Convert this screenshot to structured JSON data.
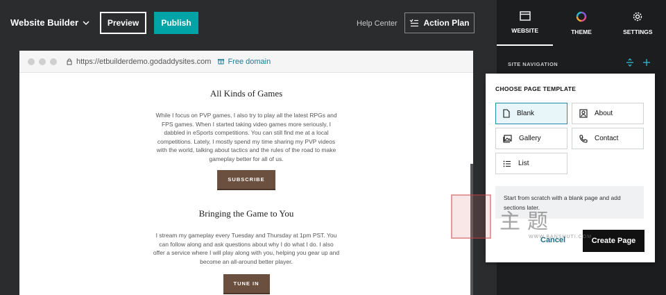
{
  "topbar": {
    "brand": "Website Builder",
    "preview_label": "Preview",
    "publish_label": "Publish",
    "help_label": "Help Center",
    "action_plan_label": "Action Plan"
  },
  "browser": {
    "url": "https://etbuilderdemo.godaddysites.com",
    "free_domain": "Free domain"
  },
  "site": {
    "sections": [
      {
        "title": "All Kinds of Games",
        "body": "While I focus on PVP games, I also try to play all the latest RPGs and FPS games. When I started taking video games more seriously, I dabbled in eSports competitions. You can still find me at a local competitions. Lately, I mostly spend my time sharing my PVP videos with the world, talking about tactics and the rules of the road to make gameplay better for all of us.",
        "button": "SUBSCRIBE"
      },
      {
        "title": "Bringing the Game to You",
        "body": "I stream my gameplay every Tuesday and Thursday at 1pm PST. You can follow along and ask questions about why I do what I do. I also offer a service where I will play along with you, helping you gear up and become an all-around better player.",
        "button": "TUNE IN"
      }
    ]
  },
  "panel": {
    "tabs": [
      {
        "label": "WEBSITE",
        "icon": "browser-window-icon"
      },
      {
        "label": "THEME",
        "icon": "color-wheel-icon"
      },
      {
        "label": "SETTINGS",
        "icon": "gear-icon"
      }
    ],
    "nav_label": "SITE NAVIGATION"
  },
  "template_picker": {
    "title": "CHOOSE PAGE TEMPLATE",
    "templates": [
      {
        "label": "Blank",
        "icon": "page-icon",
        "selected": true
      },
      {
        "label": "About",
        "icon": "portrait-icon"
      },
      {
        "label": "Gallery",
        "icon": "image-icon"
      },
      {
        "label": "Contact",
        "icon": "phone-icon"
      },
      {
        "label": "List",
        "icon": "list-icon"
      }
    ],
    "description": "Start from scratch with a blank page and add sections later.",
    "cancel_label": "Cancel",
    "create_label": "Create Page"
  },
  "watermark": {
    "text": "主题",
    "url": "WWW.BANSHUTI.COM"
  },
  "colors": {
    "accent": "#00a4a6",
    "button_brown": "#6b4f3f",
    "panel_bg": "#1c1d1f",
    "app_bg": "#2b2c2e"
  }
}
